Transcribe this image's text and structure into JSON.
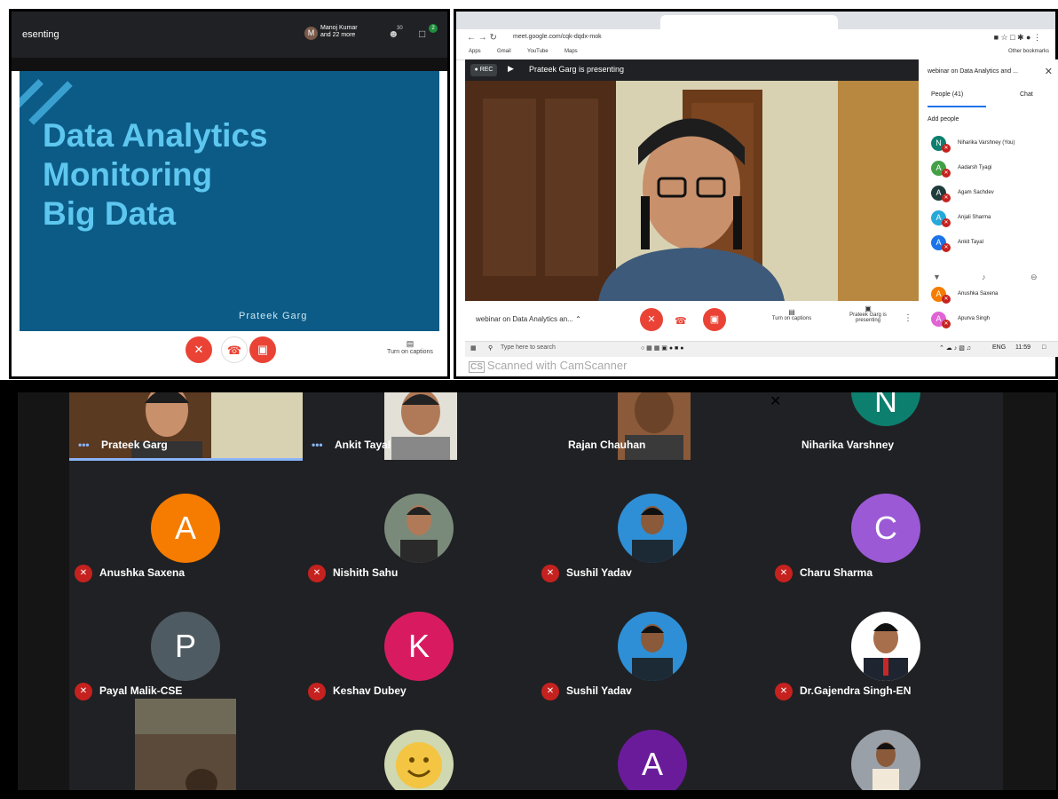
{
  "panel1": {
    "header_title": "esenting",
    "presenter_avatar_letter": "M",
    "presenter_name": "Manoj Kumar",
    "presenter_more": "and 22 more",
    "people_count": "30",
    "chat_badge": "2",
    "slide_lines": [
      "Data Analytics",
      "Monitoring",
      "Big Data"
    ],
    "slide_author": "Prateek Garg",
    "captions_label": "Turn on captions"
  },
  "panel2": {
    "url": "meet.google.com/cqk-dqdx-mok",
    "bookmarks": [
      "Apps",
      "Gmail",
      "YouTube",
      "Maps"
    ],
    "other_bookmarks": "Other bookmarks",
    "rec_label": "REC",
    "presenting_label": "Prateek Garg is presenting",
    "side_title": "webinar on Data Analytics and ...",
    "people_tab": "People (41)",
    "chat_tab": "Chat",
    "add_people": "Add people",
    "people": [
      {
        "letter": "N",
        "name": "Niharika Varshney (You)",
        "color": "#0d7f6e"
      },
      {
        "letter": "A",
        "name": "Aadarsh Tyagi",
        "color": "#43a047"
      },
      {
        "letter": "A",
        "name": "Agam Sachdev",
        "color": "#1f3b3b"
      },
      {
        "letter": "A",
        "name": "Anjali Sharma",
        "color": "#26a8d9"
      },
      {
        "letter": "A",
        "name": "Ankit Tayal",
        "color": "#1a73e8"
      },
      {
        "letter": "A",
        "name": "Anushka Saxena",
        "color": "#f57c00"
      },
      {
        "letter": "A",
        "name": "Apurva Singh",
        "color": "#e064d3"
      }
    ],
    "meeting_title": "webinar on Data Analytics an...",
    "captions_label": "Turn on captions",
    "presenting_button": "Prateek Garg is presenting",
    "search_placeholder": "Type here to search",
    "lang": "ENG",
    "time": "11:59",
    "scan_brand": "CS",
    "scan_text": "Scanned with CamScanner"
  },
  "grid": {
    "video_tiles": [
      {
        "name": "Prateek Garg",
        "talking": true
      },
      {
        "name": "Ankit Tayal",
        "talking": true
      },
      {
        "name": "Rajan Chauhan",
        "talking": false
      },
      {
        "name": "Niharika Varshney",
        "talking": false,
        "letter": "N",
        "color": "#0d7f6e"
      }
    ],
    "tiles": [
      {
        "name": "Anushka Saxena",
        "letter": "A",
        "color": "#f57c00"
      },
      {
        "name": "Nishith Sahu",
        "photo": true
      },
      {
        "name": "Sushil Yadav",
        "photo": true
      },
      {
        "name": "Charu Sharma",
        "letter": "C",
        "color": "#9b59d6"
      },
      {
        "name": "Payal Malik-CSE",
        "letter": "P",
        "color": "#4f5b62"
      },
      {
        "name": "Keshav Dubey",
        "letter": "K",
        "color": "#d81b60"
      },
      {
        "name": "Sushil Yadav",
        "photo": true
      },
      {
        "name": "Dr.Gajendra Singh-EN",
        "photo": true
      }
    ],
    "bottom_row": [
      {
        "photo": true
      },
      {
        "photo": true
      },
      {
        "letter": "A",
        "color": "#6a1b9a"
      },
      {
        "photo": true
      }
    ]
  }
}
